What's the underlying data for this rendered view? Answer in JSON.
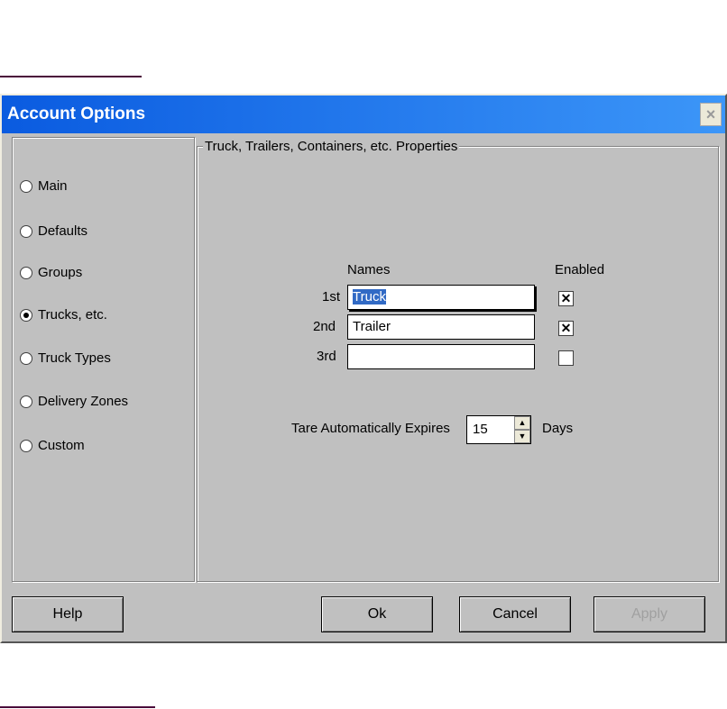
{
  "window": {
    "title": "Account Options",
    "close": "×"
  },
  "sidebar": {
    "items": [
      {
        "label": "Main",
        "selected": false
      },
      {
        "label": "Defaults",
        "selected": false
      },
      {
        "label": "Groups",
        "selected": false
      },
      {
        "label": "Trucks, etc.",
        "selected": true
      },
      {
        "label": "Truck Types",
        "selected": false
      },
      {
        "label": "Delivery Zones",
        "selected": false
      },
      {
        "label": "Custom",
        "selected": false
      }
    ]
  },
  "group": {
    "title": "Truck, Trailers, Containers, etc. Properties",
    "names_header": "Names",
    "enabled_header": "Enabled",
    "rows": [
      {
        "label": "1st",
        "value": "Truck",
        "enabled": true
      },
      {
        "label": "2nd",
        "value": "Trailer",
        "enabled": true
      },
      {
        "label": "3rd",
        "value": "",
        "enabled": false
      }
    ],
    "tare_label": "Tare Automatically Expires",
    "tare_value": "15",
    "tare_unit": "Days"
  },
  "buttons": {
    "help": "Help",
    "ok": "Ok",
    "cancel": "Cancel",
    "apply": "Apply"
  }
}
